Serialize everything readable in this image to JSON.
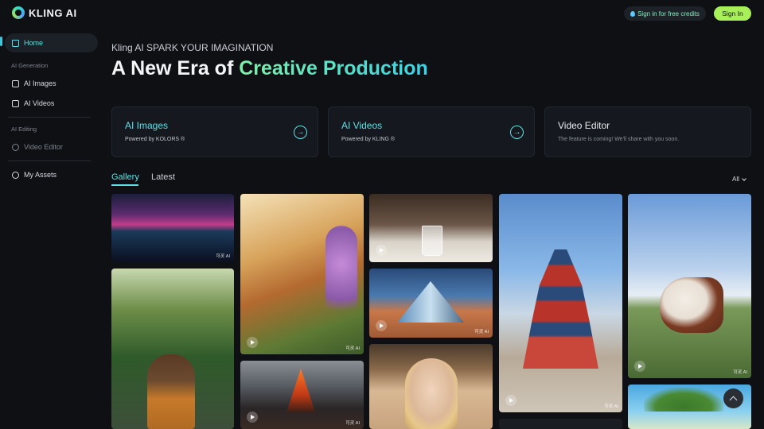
{
  "header": {
    "logo_text": "KLING AI",
    "credits_button": "Sign in for free credits",
    "signin_button": "Sign In"
  },
  "sidebar": {
    "home": "Home",
    "section_generation": "AI Generation",
    "ai_images": "AI Images",
    "ai_videos": "AI Videos",
    "section_editing": "AI Editing",
    "video_editor": "Video Editor",
    "my_assets": "My Assets"
  },
  "hero": {
    "kicker": "Kling AI SPARK YOUR IMAGINATION",
    "headline_plain": "A New Era of ",
    "headline_accent": "Creative Production"
  },
  "cards": [
    {
      "title": "AI Images",
      "subtitle": "Powered by KOLORS ®"
    },
    {
      "title": "AI Videos",
      "subtitle": "Powered by KLING ®"
    },
    {
      "title": "Video Editor",
      "subtitle": "The feature is coming! We'll share with you soon."
    }
  ],
  "tabs": {
    "gallery": "Gallery",
    "latest": "Latest"
  },
  "filter": {
    "selected": "All"
  },
  "gallery": {
    "watermark": "可灵 AI"
  },
  "colors": {
    "accent": "#5ee0e6",
    "signin": "#a8f05a",
    "background": "#0e1014"
  }
}
